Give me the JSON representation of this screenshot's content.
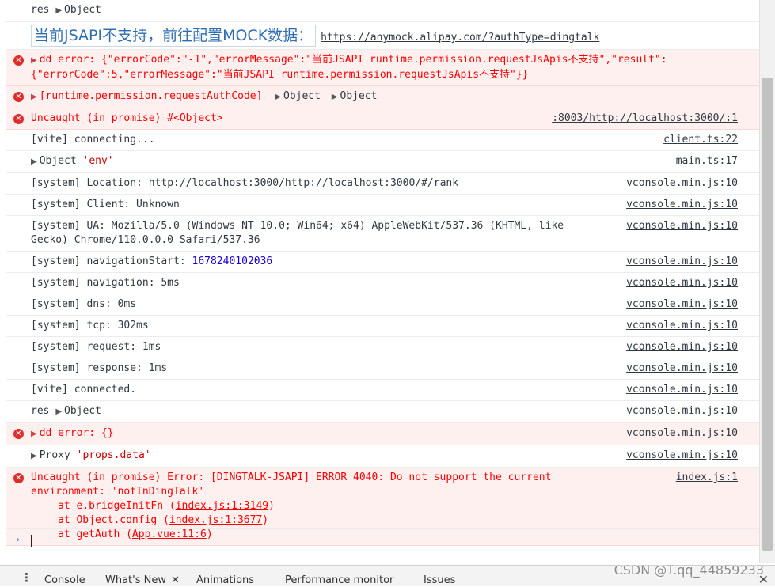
{
  "logs": {
    "r0": {
      "label": "res",
      "obj": "Object"
    },
    "r1": {
      "mock_text": "当前JSAPI不支持，前往配置MOCK数据：",
      "mock_url": "https://anymock.alipay.com/?authType=dingtalk"
    },
    "r2": {
      "text": "dd error: {\"errorCode\":\"-1\",\"errorMessage\":\"当前JSAPI runtime.permission.requestJsApis不支持\",\"result\":\n{\"errorCode\":5,\"errorMessage\":\"当前JSAPI runtime.permission.requestJsApis不支持\"}}"
    },
    "r3": {
      "text": "[runtime.permission.requestAuthCode]",
      "obj1": "Object",
      "obj2": "Object"
    },
    "r4": {
      "text": "Uncaught (in promise) #<Object>",
      "source": ":8003/http://localhost:3000/:1"
    },
    "r5": {
      "text": "[vite] connecting...",
      "source": "client.ts:22"
    },
    "r6": {
      "label": "Object",
      "str": "'env'",
      "source": "main.ts:17"
    },
    "r7": {
      "prefix": "[system] Location: ",
      "link": "http://localhost:3000/http://localhost:3000/#/rank",
      "source": "vconsole.min.js:10"
    },
    "r8": {
      "text": "[system] Client: Unknown",
      "source": "vconsole.min.js:10"
    },
    "r9": {
      "text": "[system] UA: Mozilla/5.0 (Windows NT 10.0; Win64; x64) AppleWebKit/537.36 (KHTML, like\nGecko) Chrome/110.0.0.0 Safari/537.36",
      "source": "vconsole.min.js:10"
    },
    "r10": {
      "prefix": "[system] navigationStart: ",
      "num": "1678240102036",
      "source": "vconsole.min.js:10"
    },
    "r11": {
      "text": "[system] navigation: 5ms",
      "source": "vconsole.min.js:10"
    },
    "r12": {
      "text": "[system] dns: 0ms",
      "source": "vconsole.min.js:10"
    },
    "r13": {
      "text": "[system] tcp: 302ms",
      "source": "vconsole.min.js:10"
    },
    "r14": {
      "text": "[system] request: 1ms",
      "source": "vconsole.min.js:10"
    },
    "r15": {
      "text": "[system] response: 1ms",
      "source": "vconsole.min.js:10"
    },
    "r16": {
      "text": "[vite] connected.",
      "source": "vconsole.min.js:10"
    },
    "r17": {
      "label": "res",
      "obj": "Object",
      "source": "vconsole.min.js:10"
    },
    "r18": {
      "text": "dd error: {}",
      "source": "vconsole.min.js:10"
    },
    "r19": {
      "label": "Proxy",
      "str": "'props.data'",
      "source": "vconsole.min.js:10"
    },
    "r20": {
      "text": "Uncaught (in promise) Error: [DINGTALK-JSAPI] ERROR 4040: Do not support the current\nenvironment: 'notInDingTalk'",
      "source": "index.js:1",
      "stack": [
        {
          "prefix": "at e.bridgeInitFn (",
          "link": "index.js:1:3149",
          "suffix": ")"
        },
        {
          "prefix": "at Object.config (",
          "link": "index.js:1:3677",
          "suffix": ")"
        },
        {
          "prefix": "at getAuth (",
          "link": "App.vue:11:6",
          "suffix": ")"
        }
      ]
    }
  },
  "prompt": {
    "chevron": "›"
  },
  "drawer": {
    "menu_icon": "⋮",
    "tabs": [
      "Console",
      "What's New",
      "Animations",
      "Performance monitor",
      "Issues"
    ],
    "close": "✕"
  },
  "watermark": "CSDN @T.qq_44859233",
  "icons": {
    "error": "error-icon",
    "expand": "triangle-right-icon"
  },
  "colors": {
    "error_bg": "#fff0f0",
    "error_text": "#ff0000",
    "number": "#1c00cf",
    "string": "#c80000",
    "link_blue": "#2e6db4"
  }
}
